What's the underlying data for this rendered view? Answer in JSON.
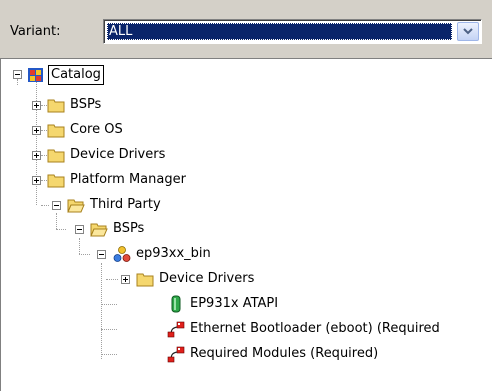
{
  "variant": {
    "label": "Variant:",
    "selected": "ALL"
  },
  "tree": {
    "root": "Catalog",
    "level1": [
      "BSPs",
      "Core OS",
      "Device Drivers",
      "Platform Manager",
      "Third Party"
    ],
    "third_party_child": "BSPs",
    "bsp": "ep93xx_bin",
    "bsp_children": [
      "Device Drivers",
      "EP931x ATAPI",
      "Ethernet Bootloader (eboot) (Required",
      "Required Modules (Required)"
    ]
  },
  "colors": {
    "selection": "#0a246a",
    "folder": "#f5d76e",
    "window": "#d4d0c8"
  }
}
